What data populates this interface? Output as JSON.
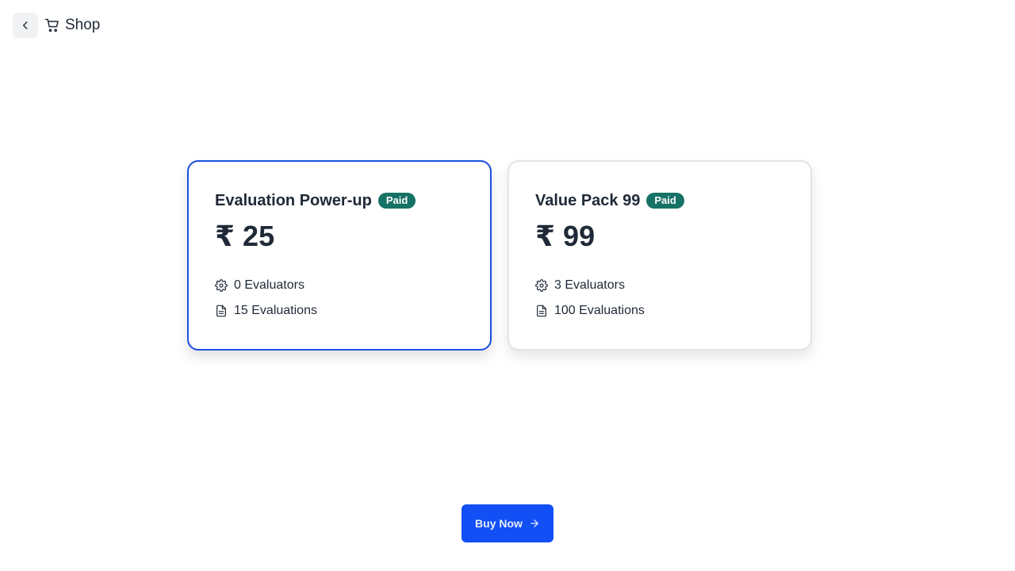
{
  "header": {
    "back_icon": "chevron-left-icon",
    "cart_icon": "shopping-cart-icon",
    "title": "Shop"
  },
  "plans": [
    {
      "title": "Evaluation Power-up",
      "badge": "Paid",
      "price": "₹ 25",
      "selected": true,
      "features": [
        {
          "icon": "gear-icon",
          "text": "0 Evaluators"
        },
        {
          "icon": "document-icon",
          "text": "15 Evaluations"
        }
      ]
    },
    {
      "title": "Value Pack 99",
      "badge": "Paid",
      "price": "₹ 99",
      "selected": false,
      "features": [
        {
          "icon": "gear-icon",
          "text": "3 Evaluators"
        },
        {
          "icon": "document-icon",
          "text": "100 Evaluations"
        }
      ]
    }
  ],
  "buy_button": {
    "label": "Buy Now",
    "icon": "arrow-right-icon"
  },
  "colors": {
    "accent": "#124ff5",
    "selected_border": "#1a4fe0",
    "badge": "#167265",
    "text": "#1f2937"
  }
}
